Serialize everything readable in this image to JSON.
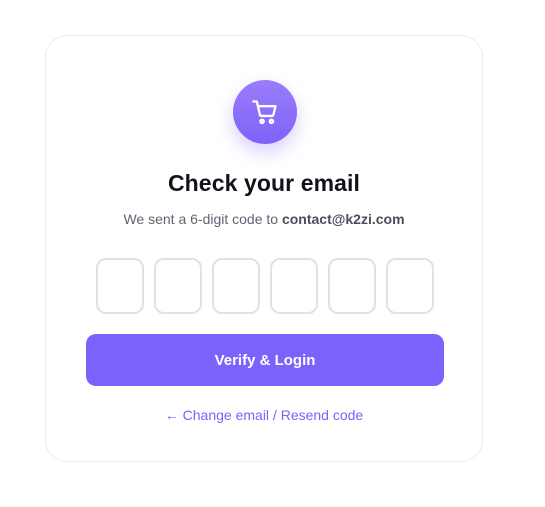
{
  "brand": {
    "icon": "shopping-cart-icon",
    "accent_color": "#7a62fa"
  },
  "heading": {
    "title": "Check your email",
    "subtitle_prefix": "We sent a 6-digit code to ",
    "email": "contact@k2zi.com"
  },
  "otp": {
    "digits": [
      "",
      "",
      "",
      "",
      "",
      ""
    ]
  },
  "actions": {
    "verify_label": "Verify & Login",
    "change_label": "← Change email / Resend code"
  }
}
